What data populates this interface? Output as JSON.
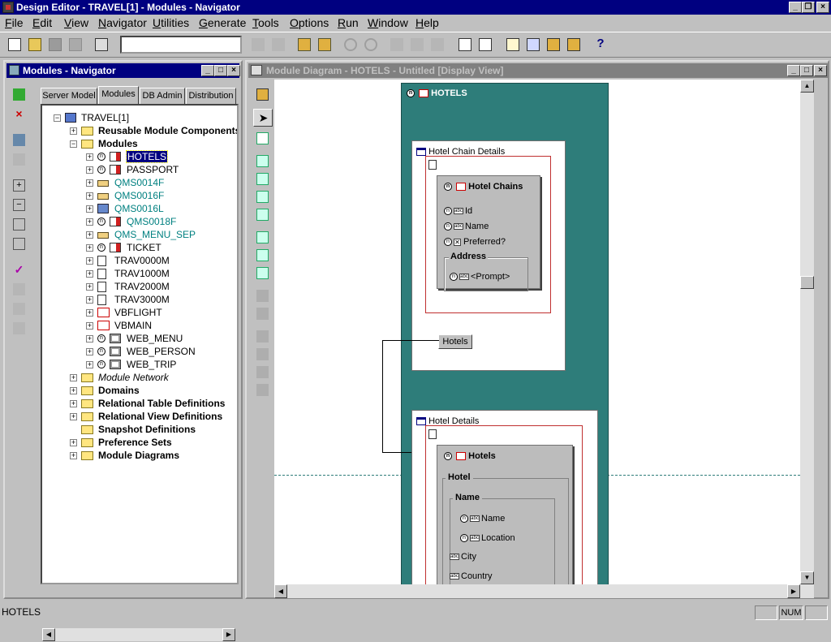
{
  "app": {
    "title": "Design Editor - TRAVEL[1] - Modules - Navigator"
  },
  "menu": [
    "File",
    "Edit",
    "View",
    "Navigator",
    "Utilities",
    "Generate",
    "Tools",
    "Options",
    "Run",
    "Window",
    "Help"
  ],
  "toolbar": {
    "search_value": ""
  },
  "navigator": {
    "title": "Modules - Navigator",
    "tabs": [
      "Server Model",
      "Modules",
      "DB Admin",
      "Distribution"
    ],
    "active_tab": "Modules",
    "root": "TRAVEL[1]",
    "tree": [
      {
        "label": "Reusable Module Components",
        "level": 1,
        "icon": "folder-icon",
        "style": "bold",
        "expander": "+"
      },
      {
        "label": "Modules",
        "level": 1,
        "icon": "open-folder-icon",
        "style": "bold",
        "expander": "-"
      },
      {
        "label": "HOTELS",
        "level": 2,
        "icon": "screen-module-icon",
        "style": "selected",
        "expander": "+"
      },
      {
        "label": "PASSPORT",
        "level": 2,
        "icon": "screen-module-icon",
        "style": "normal",
        "expander": "+"
      },
      {
        "label": "QMS0014F",
        "level": 2,
        "icon": "hand-module-icon",
        "style": "teal",
        "expander": "+"
      },
      {
        "label": "QMS0016F",
        "level": 2,
        "icon": "hand-module-icon",
        "style": "teal",
        "expander": "+"
      },
      {
        "label": "QMS0016L",
        "level": 2,
        "icon": "library-module-icon",
        "style": "teal",
        "expander": "+"
      },
      {
        "label": "QMS0018F",
        "level": 2,
        "icon": "screen-module-icon",
        "style": "teal",
        "expander": "+"
      },
      {
        "label": "QMS_MENU_SEP",
        "level": 2,
        "icon": "hand-module-icon",
        "style": "teal",
        "expander": "+"
      },
      {
        "label": "TICKET",
        "level": 2,
        "icon": "screen-module-icon",
        "style": "normal",
        "expander": "+"
      },
      {
        "label": "TRAV0000M",
        "level": 2,
        "icon": "report-module-icon",
        "style": "normal",
        "expander": "+"
      },
      {
        "label": "TRAV1000M",
        "level": 2,
        "icon": "report-module-icon",
        "style": "normal",
        "expander": "+"
      },
      {
        "label": "TRAV2000M",
        "level": 2,
        "icon": "report-module-icon",
        "style": "normal",
        "expander": "+"
      },
      {
        "label": "TRAV3000M",
        "level": 2,
        "icon": "report-module-icon",
        "style": "normal",
        "expander": "+"
      },
      {
        "label": "VBFLIGHT",
        "level": 2,
        "icon": "vb-module-icon",
        "style": "normal",
        "expander": "+"
      },
      {
        "label": "VBMAIN",
        "level": 2,
        "icon": "vb-module-icon",
        "style": "normal",
        "expander": "+"
      },
      {
        "label": "WEB_MENU",
        "level": 2,
        "icon": "web-module-icon",
        "style": "normal",
        "expander": "+"
      },
      {
        "label": "WEB_PERSON",
        "level": 2,
        "icon": "web-module-icon",
        "style": "normal",
        "expander": "+"
      },
      {
        "label": "WEB_TRIP",
        "level": 2,
        "icon": "web-module-icon",
        "style": "normal",
        "expander": "+"
      },
      {
        "label": "Module Network",
        "level": 1,
        "icon": "folder-icon",
        "style": "italic",
        "expander": "+"
      },
      {
        "label": "Domains",
        "level": 1,
        "icon": "folder-icon",
        "style": "bold",
        "expander": "+"
      },
      {
        "label": "Relational Table Definitions",
        "level": 1,
        "icon": "folder-icon",
        "style": "bold",
        "expander": "+"
      },
      {
        "label": "Relational View Definitions",
        "level": 1,
        "icon": "folder-icon",
        "style": "bold",
        "expander": "+"
      },
      {
        "label": "Snapshot Definitions",
        "level": 1,
        "icon": "folder-icon",
        "style": "bold",
        "expander": ""
      },
      {
        "label": "Preference Sets",
        "level": 1,
        "icon": "folder-icon",
        "style": "bold",
        "expander": "+"
      },
      {
        "label": "Module Diagrams",
        "level": 1,
        "icon": "folder-icon",
        "style": "bold",
        "expander": "+"
      }
    ]
  },
  "diagram": {
    "title": "Module Diagram - HOTELS - Untitled [Display View]",
    "module_name": "HOTELS",
    "window1": {
      "title": "Hotel Chain Details",
      "block": "Hotel Chains",
      "items": [
        "Id",
        "Name",
        "Preferred?"
      ],
      "group": "Address",
      "group_item": "<Prompt>",
      "button": "Hotels"
    },
    "window2": {
      "title": "Hotel Details",
      "block": "Hotels",
      "group": "Hotel",
      "subgroup": "Name",
      "items": [
        "Name",
        "Location",
        "City",
        "Country"
      ]
    }
  },
  "status": {
    "text": "HOTELS",
    "num": "NUM"
  }
}
